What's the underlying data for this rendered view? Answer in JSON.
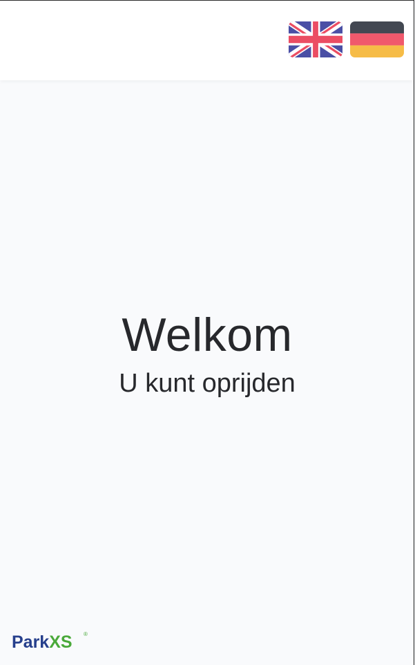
{
  "header": {
    "languages": [
      {
        "code": "en",
        "icon": "uk-flag-icon"
      },
      {
        "code": "de",
        "icon": "german-flag-icon"
      }
    ]
  },
  "welcome": {
    "title": "Welkom",
    "subtitle": "U kunt oprijden"
  },
  "logo": {
    "part_a": "Park",
    "part_b": "XS",
    "registered": "®"
  },
  "colors": {
    "background": "#f9fafc",
    "header": "#ffffff",
    "text": "#27282c",
    "logo_blue": "#263f8c",
    "logo_green": "#4aa93a",
    "uk_blue": "#4a4fa5",
    "uk_red": "#eb4d63",
    "de_black": "#434852",
    "de_red": "#f0596c",
    "de_gold": "#f6bc47"
  }
}
